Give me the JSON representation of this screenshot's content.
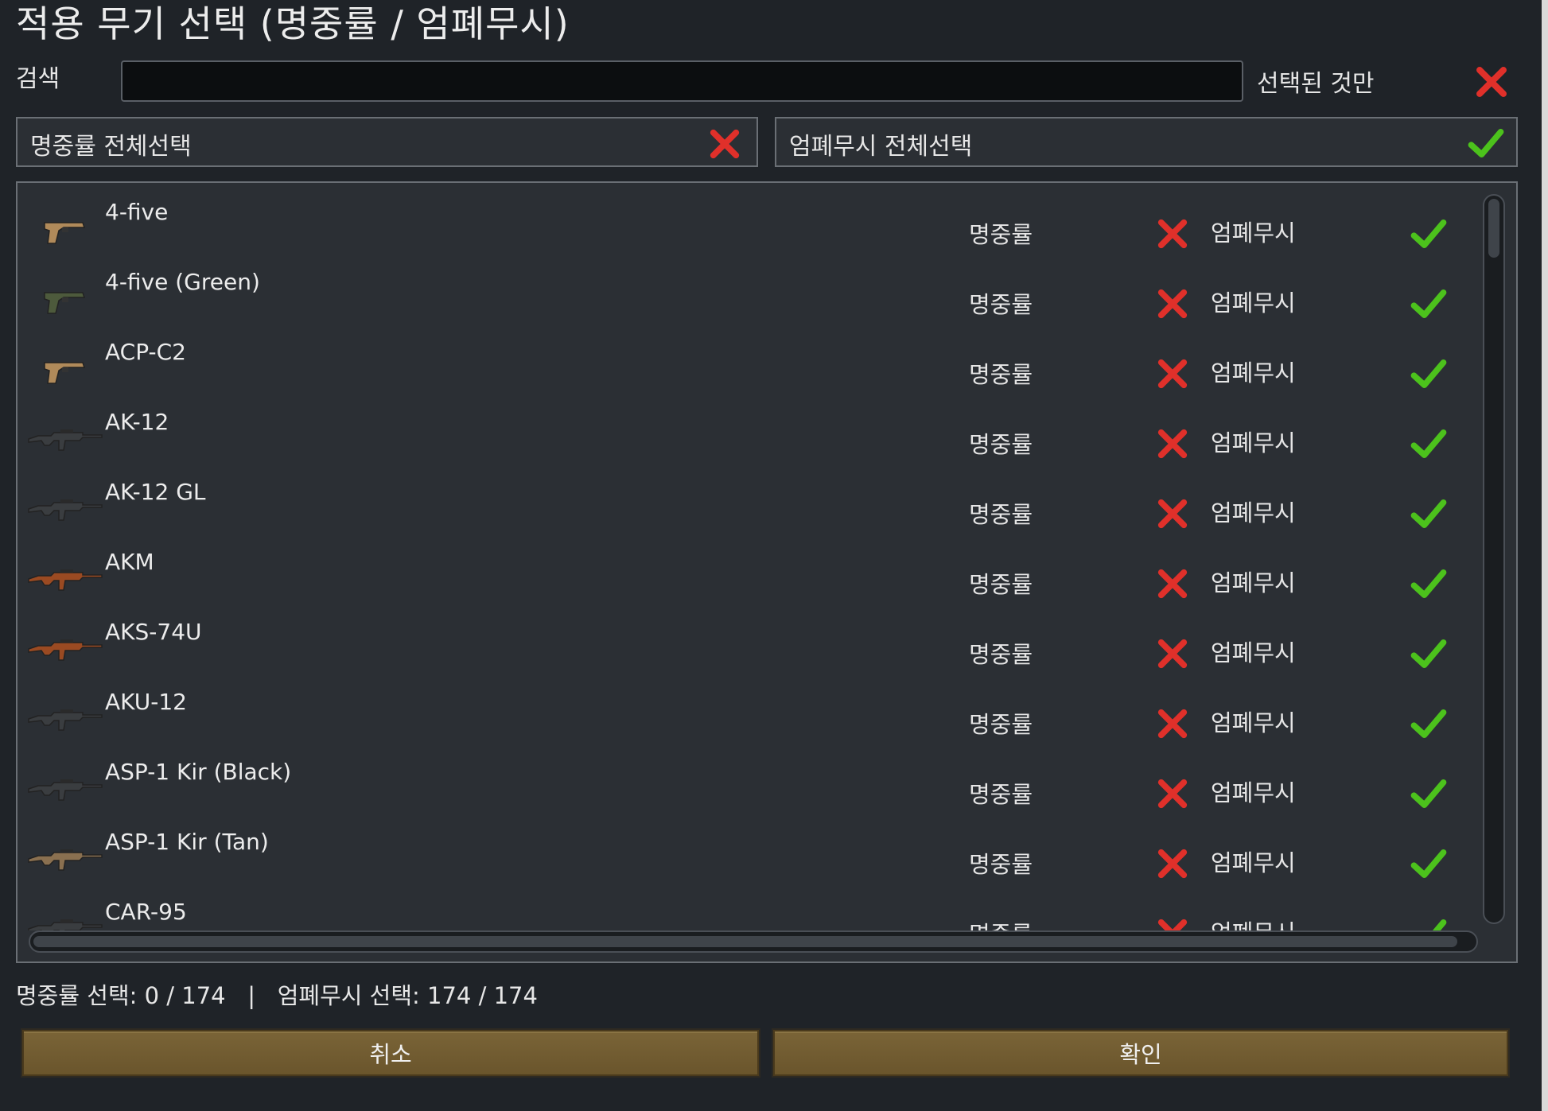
{
  "dialog": {
    "title": "적용 무기 선택 (명중률 / 엄폐무시)"
  },
  "search": {
    "label": "검색",
    "value": "",
    "placeholder": "",
    "only_selected_label": "선택된 것만",
    "only_selected_state": "off"
  },
  "select_all": {
    "accuracy": {
      "label": "명중률 전체선택",
      "state": "off"
    },
    "ignore_cover": {
      "label": "엄폐무시 전체선택",
      "state": "on"
    }
  },
  "colors": {
    "x_red": "#e0302a",
    "check_green": "#4cc21c",
    "button_brown": "#6e5830",
    "panel_bg": "#2b2f34",
    "window_bg": "#1f2328"
  },
  "weapons": [
    {
      "name": "4-five",
      "icon": "pistol-tan-icon",
      "accuracy_label": "명중률",
      "accuracy": "off",
      "cover_label": "엄폐무시",
      "ignore_cover": "on"
    },
    {
      "name": "4-five (Green)",
      "icon": "pistol-green-icon",
      "accuracy_label": "명중률",
      "accuracy": "off",
      "cover_label": "엄폐무시",
      "ignore_cover": "on"
    },
    {
      "name": "ACP-C2",
      "icon": "pistol-tan-icon",
      "accuracy_label": "명중률",
      "accuracy": "off",
      "cover_label": "엄폐무시",
      "ignore_cover": "on"
    },
    {
      "name": "AK-12",
      "icon": "rifle-dark-icon",
      "accuracy_label": "명중률",
      "accuracy": "off",
      "cover_label": "엄폐무시",
      "ignore_cover": "on"
    },
    {
      "name": "AK-12 GL",
      "icon": "rifle-dark-icon",
      "accuracy_label": "명중률",
      "accuracy": "off",
      "cover_label": "엄폐무시",
      "ignore_cover": "on"
    },
    {
      "name": "AKM",
      "icon": "rifle-wood-icon",
      "accuracy_label": "명중률",
      "accuracy": "off",
      "cover_label": "엄폐무시",
      "ignore_cover": "on"
    },
    {
      "name": "AKS-74U",
      "icon": "rifle-wood-icon",
      "accuracy_label": "명중률",
      "accuracy": "off",
      "cover_label": "엄폐무시",
      "ignore_cover": "on"
    },
    {
      "name": "AKU-12",
      "icon": "rifle-dark-icon",
      "accuracy_label": "명중률",
      "accuracy": "off",
      "cover_label": "엄폐무시",
      "ignore_cover": "on"
    },
    {
      "name": "ASP-1 Kir (Black)",
      "icon": "rifle-dark-icon",
      "accuracy_label": "명중률",
      "accuracy": "off",
      "cover_label": "엄폐무시",
      "ignore_cover": "on"
    },
    {
      "name": "ASP-1 Kir (Tan)",
      "icon": "rifle-tan-icon",
      "accuracy_label": "명중률",
      "accuracy": "off",
      "cover_label": "엄폐무시",
      "ignore_cover": "on"
    },
    {
      "name": "CAR-95",
      "icon": "rifle-dark-icon",
      "accuracy_label": "명중률",
      "accuracy": "off",
      "cover_label": "엄폐무시",
      "ignore_cover": "on"
    }
  ],
  "summary": {
    "accuracy_text": "명중률 선택: 0 / 174",
    "separator": "|",
    "cover_text": "엄폐무시 선택: 174 / 174"
  },
  "buttons": {
    "cancel": "취소",
    "confirm": "확인"
  }
}
